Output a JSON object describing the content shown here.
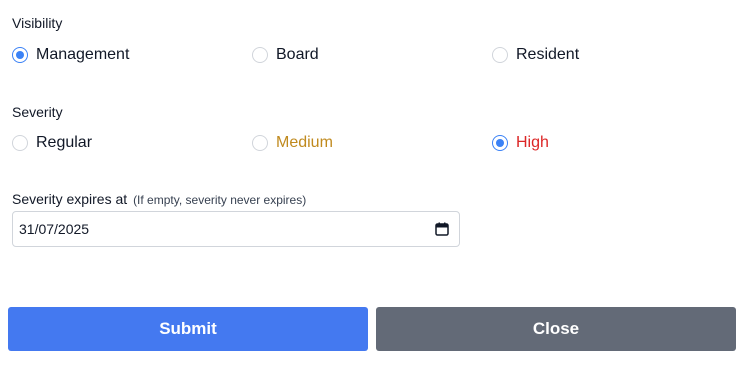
{
  "visibility": {
    "label": "Visibility",
    "options": [
      {
        "label": "Management",
        "checked": true
      },
      {
        "label": "Board",
        "checked": false
      },
      {
        "label": "Resident",
        "checked": false
      }
    ]
  },
  "severity": {
    "label": "Severity",
    "options": [
      {
        "label": "Regular",
        "checked": false,
        "color": "#111827"
      },
      {
        "label": "Medium",
        "checked": false,
        "color": "#c08a1e"
      },
      {
        "label": "High",
        "checked": true,
        "color": "#dc2626"
      }
    ]
  },
  "expires": {
    "label": "Severity expires at",
    "hint": "(If empty, severity never expires)",
    "value": "31/07/2025",
    "icon": "calendar-icon"
  },
  "buttons": {
    "submit_label": "Submit",
    "close_label": "Close"
  },
  "colors": {
    "accent": "#3b82f6",
    "submit": "#4479f0",
    "close": "#636a77"
  }
}
